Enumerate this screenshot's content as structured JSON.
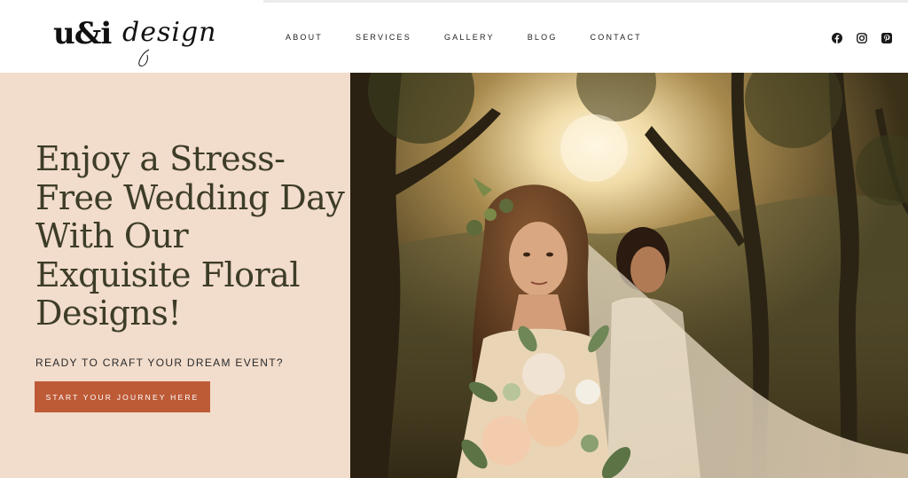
{
  "header": {
    "logo": {
      "mark": "u&i",
      "script": "design"
    },
    "nav": [
      {
        "label": "ABOUT"
      },
      {
        "label": "SERVICES"
      },
      {
        "label": "GALLERY"
      },
      {
        "label": "BLOG"
      },
      {
        "label": "CONTACT"
      }
    ],
    "social": [
      {
        "icon": "facebook-icon"
      },
      {
        "icon": "instagram-icon"
      },
      {
        "icon": "pinterest-icon"
      }
    ]
  },
  "hero": {
    "headline_lines": [
      "Enjoy a Stress-",
      "Free Wedding Day",
      "With Our",
      "Exquisite Floral",
      "Designs!"
    ],
    "subhead": "READY TO CRAFT YOUR DREAM EVENT?",
    "cta_label": "START YOUR JOURNEY HERE",
    "panel_color": "#f2dccb",
    "cta_color": "#bd5b37",
    "photo": {
      "subject": "bride-with-bouquet-and-veil-photo"
    }
  }
}
